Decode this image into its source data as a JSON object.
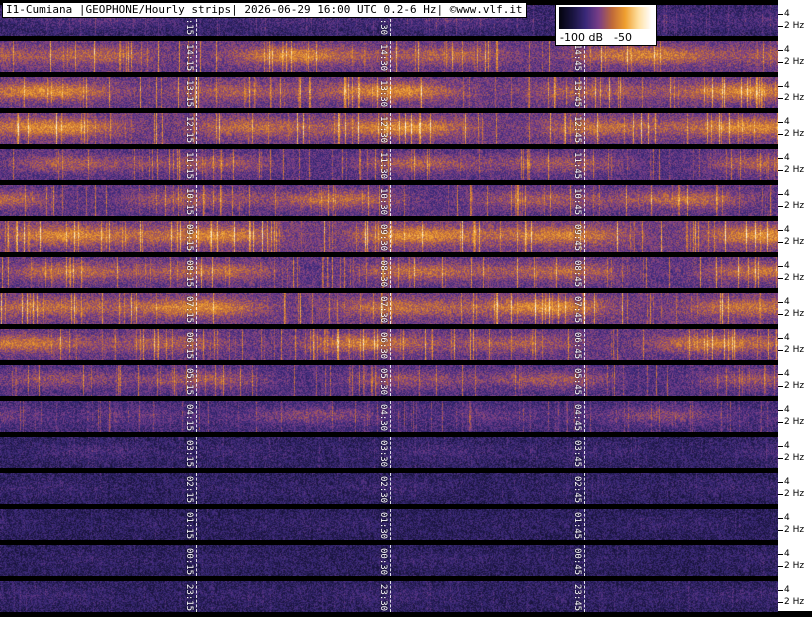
{
  "title": "I1-Cumiana |GEOPHONE/Hourly strips| 2026-06-29 16:00 UTC 0.2-6 Hz| ©www.vlf.it",
  "colorbar": {
    "min_label": "-100 dB",
    "max_label": "-50",
    "colors": [
      "#050510",
      "#1a1540",
      "#3b2a7a",
      "#7a3f88",
      "#c06a3a",
      "#f0a030",
      "#ffe0a0",
      "#ffffff"
    ]
  },
  "axis": {
    "upper_label": "4",
    "lower_label": "2 Hz"
  },
  "strips": [
    {
      "labels": [
        "15:15",
        "15:30",
        "15:45"
      ],
      "activity": 0.3
    },
    {
      "labels": [
        "14:15",
        "14:30",
        "14:45"
      ],
      "activity": 0.8
    },
    {
      "labels": [
        "13:15",
        "13:30",
        "13:45"
      ],
      "activity": 0.8
    },
    {
      "labels": [
        "12:15",
        "12:30",
        "12:45"
      ],
      "activity": 0.85
    },
    {
      "labels": [
        "11:15",
        "11:30",
        "11:45"
      ],
      "activity": 0.65
    },
    {
      "labels": [
        "10:15",
        "10:30",
        "10:45"
      ],
      "activity": 0.7
    },
    {
      "labels": [
        "09:15",
        "09:30",
        "09:45"
      ],
      "activity": 0.9
    },
    {
      "labels": [
        "08:15",
        "08:30",
        "08:45"
      ],
      "activity": 0.75
    },
    {
      "labels": [
        "07:15",
        "07:30",
        "07:45"
      ],
      "activity": 0.85
    },
    {
      "labels": [
        "06:15",
        "06:30",
        "06:45"
      ],
      "activity": 0.75
    },
    {
      "labels": [
        "05:15",
        "05:30",
        "05:45"
      ],
      "activity": 0.6
    },
    {
      "labels": [
        "04:15",
        "04:30",
        "04:45"
      ],
      "activity": 0.45
    },
    {
      "labels": [
        "03:15",
        "03:30",
        "03:45"
      ],
      "activity": 0.2
    },
    {
      "labels": [
        "02:15",
        "02:30",
        "02:45"
      ],
      "activity": 0.15
    },
    {
      "labels": [
        "01:15",
        "01:30",
        "01:45"
      ],
      "activity": 0.12
    },
    {
      "labels": [
        "00:15",
        "00:30",
        "00:45"
      ],
      "activity": 0.12
    },
    {
      "labels": [
        "23:15",
        "23:30",
        "23:45"
      ],
      "activity": 0.15
    }
  ]
}
